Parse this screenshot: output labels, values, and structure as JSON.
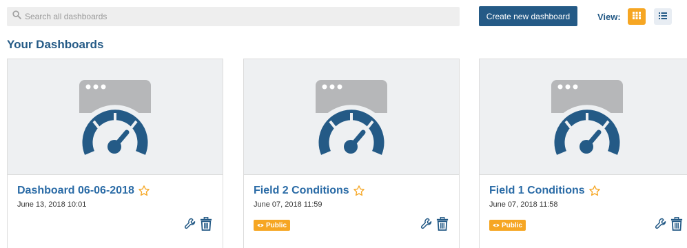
{
  "search": {
    "placeholder": "Search all dashboards"
  },
  "toolbar": {
    "create_label": "Create new dashboard",
    "view_label": "View:",
    "view_modes": [
      {
        "name": "grid",
        "icon": "grid-icon",
        "active": true
      },
      {
        "name": "list",
        "icon": "list-icon",
        "active": false
      }
    ]
  },
  "section": {
    "title": "Your Dashboards"
  },
  "dashboards": [
    {
      "title": "Dashboard 06-06-2018",
      "date": "June 13, 2018 10:01",
      "public": false,
      "badge": ""
    },
    {
      "title": "Field 2 Conditions",
      "date": "June 07, 2018 11:59",
      "public": true,
      "badge": "Public"
    },
    {
      "title": "Field 1 Conditions",
      "date": "June 07, 2018 11:58",
      "public": true,
      "badge": "Public"
    }
  ],
  "colors": {
    "primary": "#245a86",
    "link": "#2a6ba6",
    "accent": "#f6a623",
    "thumbnail_bg": "#eef0f2",
    "gauge": "#245a86",
    "window": "#b6b7b9"
  },
  "icons": {
    "search": "search-icon",
    "star": "star-outline-icon",
    "edit": "wrench-icon",
    "delete": "trash-icon",
    "public": "eye-icon",
    "thumbnail": "dashboard-gauge-icon"
  }
}
